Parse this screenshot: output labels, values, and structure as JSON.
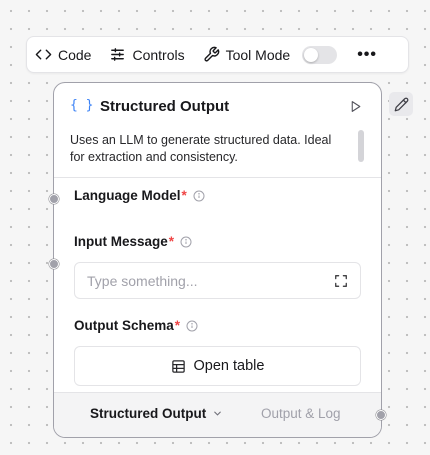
{
  "toolbar": {
    "code_label": "Code",
    "controls_label": "Controls",
    "tool_mode_label": "Tool Mode",
    "tool_mode_enabled": false,
    "more_label": "•••"
  },
  "node": {
    "icon_text": "{ }",
    "title": "Structured Output",
    "description": "Uses an LLM to generate structured data. Ideal for extraction and consistency.",
    "fields": {
      "language_model": {
        "label": "Language Model",
        "required_mark": "*"
      },
      "input_message": {
        "label": "Input Message",
        "required_mark": "*",
        "placeholder": "Type something..."
      },
      "output_schema": {
        "label": "Output Schema",
        "required_mark": "*",
        "button_label": "Open table"
      }
    },
    "footer": {
      "output_label": "Structured Output",
      "output_log_label": "Output & Log"
    }
  },
  "colors": {
    "accent": "#3b82f6",
    "required": "#ef4444",
    "border": "#a1a1aa"
  }
}
